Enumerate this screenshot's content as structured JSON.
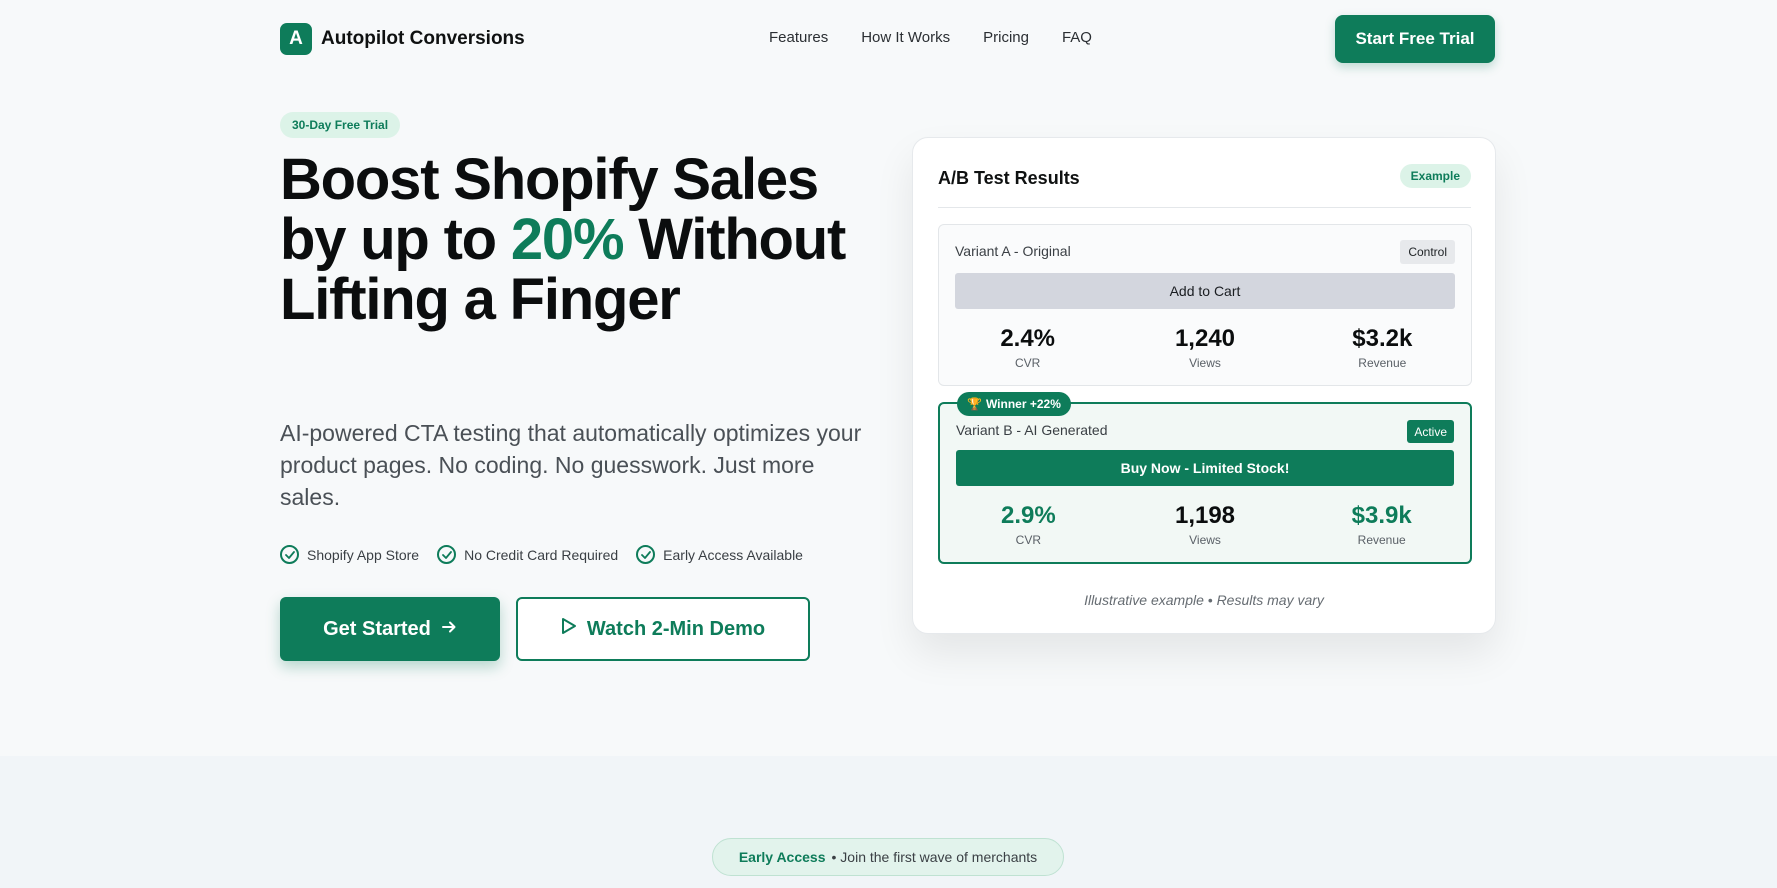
{
  "nav": {
    "logo_letter": "A",
    "brand": "Autopilot Conversions",
    "links": [
      "Features",
      "How It Works",
      "Pricing",
      "FAQ"
    ],
    "cta": "Start Free Trial"
  },
  "hero": {
    "badge": "30-Day Free Trial",
    "headline_1": "Boost Shopify Sales by up to ",
    "headline_accent": "20%",
    "headline_2": " Without Lifting a Finger",
    "subheadline": "AI-powered CTA testing that automatically optimizes your product pages. No coding. No guesswork. Just more sales.",
    "checks": [
      "Shopify App Store",
      "No Credit Card Required",
      "Early Access Available"
    ],
    "primary_cta": "Get Started",
    "secondary_cta": "Watch 2-Min Demo"
  },
  "card": {
    "title": "A/B Test Results",
    "badge": "Example",
    "variant_a": {
      "name": "Variant A - Original",
      "tag": "Control",
      "button": "Add to Cart",
      "stats": [
        {
          "value": "2.4%",
          "label": "CVR"
        },
        {
          "value": "1,240",
          "label": "Views"
        },
        {
          "value": "$3.2k",
          "label": "Revenue"
        }
      ]
    },
    "variant_b": {
      "winner": "Winner +22%",
      "name": "Variant B - AI Generated",
      "tag": "Active",
      "button": "Buy Now - Limited Stock!",
      "stats": [
        {
          "value": "2.9%",
          "label": "CVR"
        },
        {
          "value": "1,198",
          "label": "Views"
        },
        {
          "value": "$3.9k",
          "label": "Revenue"
        }
      ]
    },
    "disclaimer": "Illustrative example • Results may vary"
  },
  "early_access": {
    "label": "Early Access",
    "text": "• Join the first wave of merchants"
  },
  "colors": {
    "brand": "#0e7c5a",
    "badge_bg": "#dcf3e8"
  },
  "icons": {
    "check": "check-circle-icon",
    "arrow": "arrow-right-icon",
    "play": "play-icon",
    "trophy": "trophy-icon"
  }
}
